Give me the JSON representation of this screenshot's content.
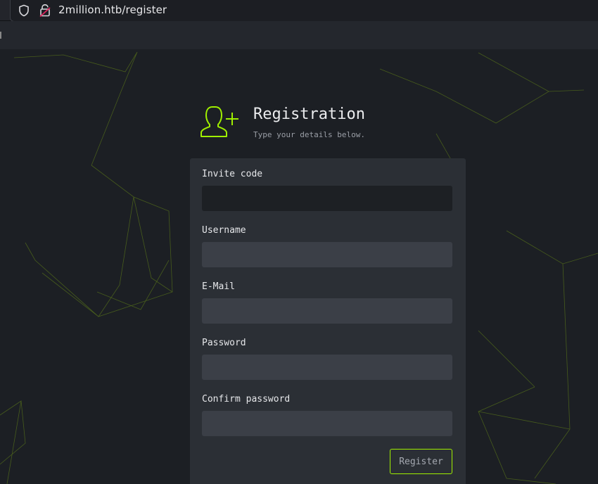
{
  "browser": {
    "url": "2million.htb/register",
    "icons": [
      "shield-icon",
      "lock-icon"
    ]
  },
  "header": {
    "icon": "user-plus-icon",
    "title": "Registration",
    "subtitle": "Type your details below."
  },
  "form": {
    "fields": [
      {
        "label": "Invite code",
        "value": "",
        "placeholder": ""
      },
      {
        "label": "Username",
        "value": "",
        "placeholder": ""
      },
      {
        "label": "E-Mail",
        "value": "",
        "placeholder": ""
      },
      {
        "label": "Password",
        "value": "",
        "placeholder": ""
      },
      {
        "label": "Confirm password",
        "value": "",
        "placeholder": ""
      }
    ],
    "submit_label": "Register"
  },
  "colors": {
    "accent": "#9fef00",
    "background": "#1c1f24",
    "card": "#2b2f35",
    "input": "#3b3f47"
  }
}
